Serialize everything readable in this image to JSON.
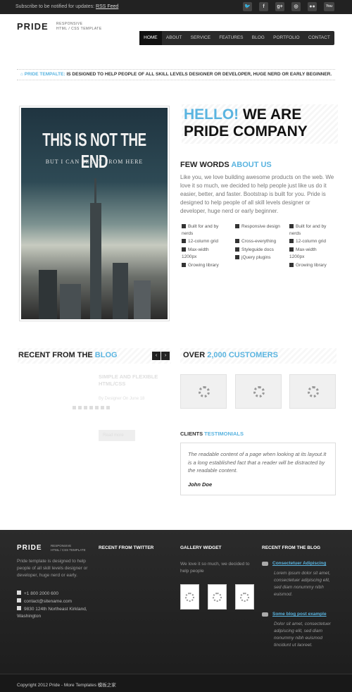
{
  "topbar": {
    "notify_text": "Subscribe to be notified for updates: ",
    "rss_label": "RSS Feed",
    "social": [
      {
        "icon": "twitter-icon",
        "glyph": "🐦"
      },
      {
        "icon": "facebook-icon",
        "glyph": "f"
      },
      {
        "icon": "google-plus-icon",
        "glyph": "g+"
      },
      {
        "icon": "dribbble-icon",
        "glyph": "◎"
      },
      {
        "icon": "flickr-icon",
        "glyph": "●●"
      },
      {
        "icon": "youtube-icon",
        "glyph": "You"
      }
    ]
  },
  "header": {
    "logo": "PRIDE",
    "logo_sub_1": "RESPONSIVE",
    "logo_sub_2": "HTML / CSS TEMPLATE",
    "nav": [
      "HOME",
      "ABOUT",
      "SERVICE",
      "FEATURES",
      "BLOG",
      "PORTFOLIO",
      "CONTACT"
    ],
    "nav_active": "HOME"
  },
  "tagline": {
    "brand": "PRIDE TEMPALTE:",
    "text": " IS DESIGNED TO HELP PEOPLE OF ALL SKILL LEVELS DESIGNER OR DEVELOPER, HUGE NERD OR EARLY BEGINNER."
  },
  "poster": {
    "title": "THIS IS NOT THE END",
    "subtitle": "BUT I CAN SEE IT FROM HERE"
  },
  "hello": {
    "blue": "HELLO!",
    "rest": " WE ARE",
    "line2": "PRIDE COMPANY"
  },
  "about": {
    "title_dark": "FEW WORDS ",
    "title_blue": "ABOUT US",
    "intro": "Like you, we love building awesome products on the web. We love it so much, we decided to help people just like us do it easier, better, and faster. Bootstrap is built for you. Pride is designed to help people of all skill levels designer or developer, huge nerd or early beginner.",
    "features_col1": [
      "Built for and by nerds",
      "12-column grid",
      "Max-width 1200px",
      "Growing library"
    ],
    "features_col2": [
      "Responsive design",
      "Cross-everything",
      "Styleguide docs",
      "jQuery plugins"
    ],
    "features_col3": [
      "Built for and by nerds",
      "12-column grid",
      "Max-width 1200px",
      "Growing library"
    ]
  },
  "blog": {
    "title_dark": "RECENT FROM THE ",
    "title_blue": "BLOG",
    "prev": "‹",
    "next": "›",
    "post_title": "SIMPLE AND FLEXIBLE HTML/CSS",
    "post_meta": "By Designer  On June 18",
    "read_more": "Read more"
  },
  "customers": {
    "title_dark": "OVER ",
    "title_blue": "2,000 CUSTOMERS"
  },
  "testimonials": {
    "title_dark": "CLIENTS ",
    "title_blue": "TESTIMONIALS",
    "quote": "The readable content of a page when looking at its layout.It is a long established fact that a reader will be distracted by the readable content.",
    "name": "John Doe"
  },
  "footer": {
    "logo": "PRIDE",
    "logo_sub_1": "RESPONSIVE",
    "logo_sub_2": "HTML / CSS TEMPLATE",
    "about": "Pride template is designed to help people of all skill levels designer or developer, huge nerd or early.",
    "phone": "+1 800 2000 600",
    "email": "contact@sitename.com",
    "address": "9830 124th Northeast Kirkland, Washington",
    "twitter_head": "RECENT FROM TWITTER",
    "gallery_head": "GALLERY WIDGET",
    "gallery_text": "We love it so much, we decided to help people",
    "blog_head": "RECENT FROM THE BLOG",
    "blog_posts": [
      {
        "title": "Consectetuer Adipiscing",
        "text": "Lorem ipsum dolor sit amet, consectetuer adipiscing elit, sed diam nonummy nibh euismod."
      },
      {
        "title": "Some blog post example",
        "text": "Dolor sit amet, consectetuer adipiscing elit, sed diam nonummy nibh euismod tincidunt ut laoreet."
      }
    ],
    "copyright": "Copyright 2012 Pride - More Templates 模板之家"
  }
}
